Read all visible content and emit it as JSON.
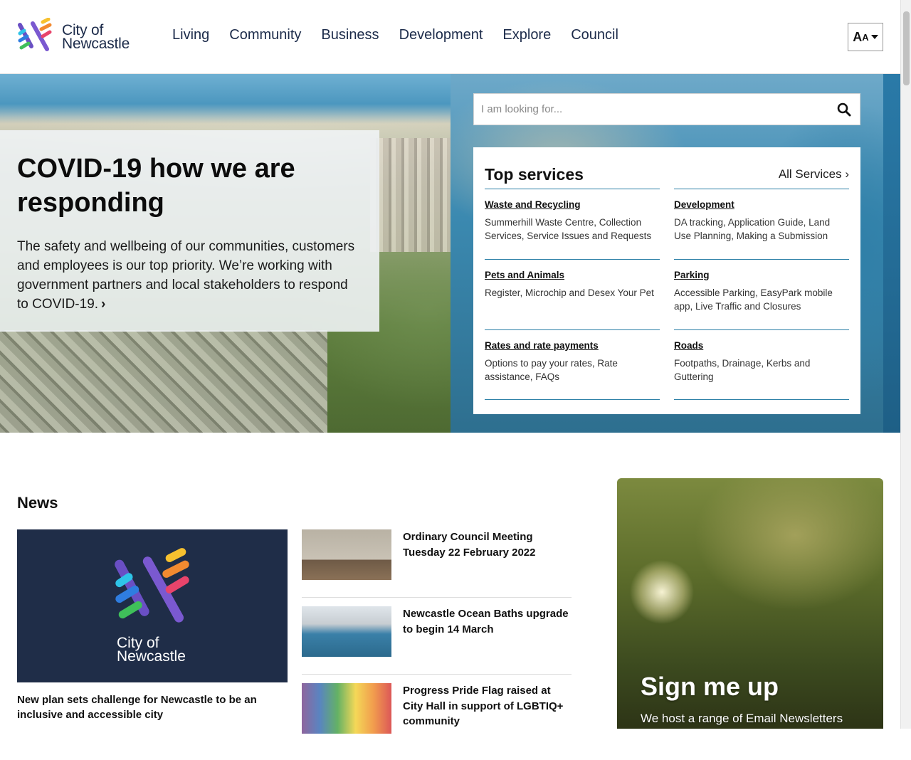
{
  "header": {
    "logo_line1": "City of",
    "logo_line2": "Newcastle",
    "nav": [
      "Living",
      "Community",
      "Business",
      "Development",
      "Explore",
      "Council"
    ],
    "text_size_label_big": "A",
    "text_size_label_small": "A"
  },
  "hero": {
    "title": "COVID-19 how we are responding",
    "text": "The safety and wellbeing of our communities, customers and employees is our top priority. We’re working with government partners and local stakeholders to respond to COVID-19.",
    "chevron": "›"
  },
  "search": {
    "placeholder": "I am looking for..."
  },
  "services": {
    "title": "Top services",
    "all_label": "All Services ›",
    "items": [
      {
        "title": "Waste and Recycling",
        "desc": "Summerhill Waste Centre, Collection Services, Service Issues and Requests"
      },
      {
        "title": "Development",
        "desc": "DA tracking, Application Guide, Land Use Planning, Making a Submission"
      },
      {
        "title": "Pets and Animals",
        "desc": "Register, Microchip and Desex Your Pet"
      },
      {
        "title": "Parking",
        "desc": "Accessible Parking, EasyPark mobile app, Live Traffic and Closures"
      },
      {
        "title": "Rates and rate payments",
        "desc": "Options to pay your rates, Rate assistance, FAQs"
      },
      {
        "title": "Roads",
        "desc": "Footpaths, Drainage, Kerbs and Guttering"
      }
    ]
  },
  "news": {
    "title": "News",
    "feature": {
      "logo_line1": "City of",
      "logo_line2": "Newcastle",
      "caption": "New plan sets challenge for Newcastle to be an inclusive and accessible city"
    },
    "items": [
      {
        "title": "Ordinary Council Meeting Tuesday 22 February 2022"
      },
      {
        "title": "Newcastle Ocean Baths upgrade to begin 14 March"
      },
      {
        "title": "Progress Pride Flag raised at City Hall in support of LGBTIQ+ community"
      }
    ]
  },
  "signup": {
    "title": "Sign me up",
    "text": "We host a range of Email Newsletters"
  },
  "colors": {
    "brand_navy": "#1c2b4a",
    "accent_blue": "#2b7fa6"
  }
}
